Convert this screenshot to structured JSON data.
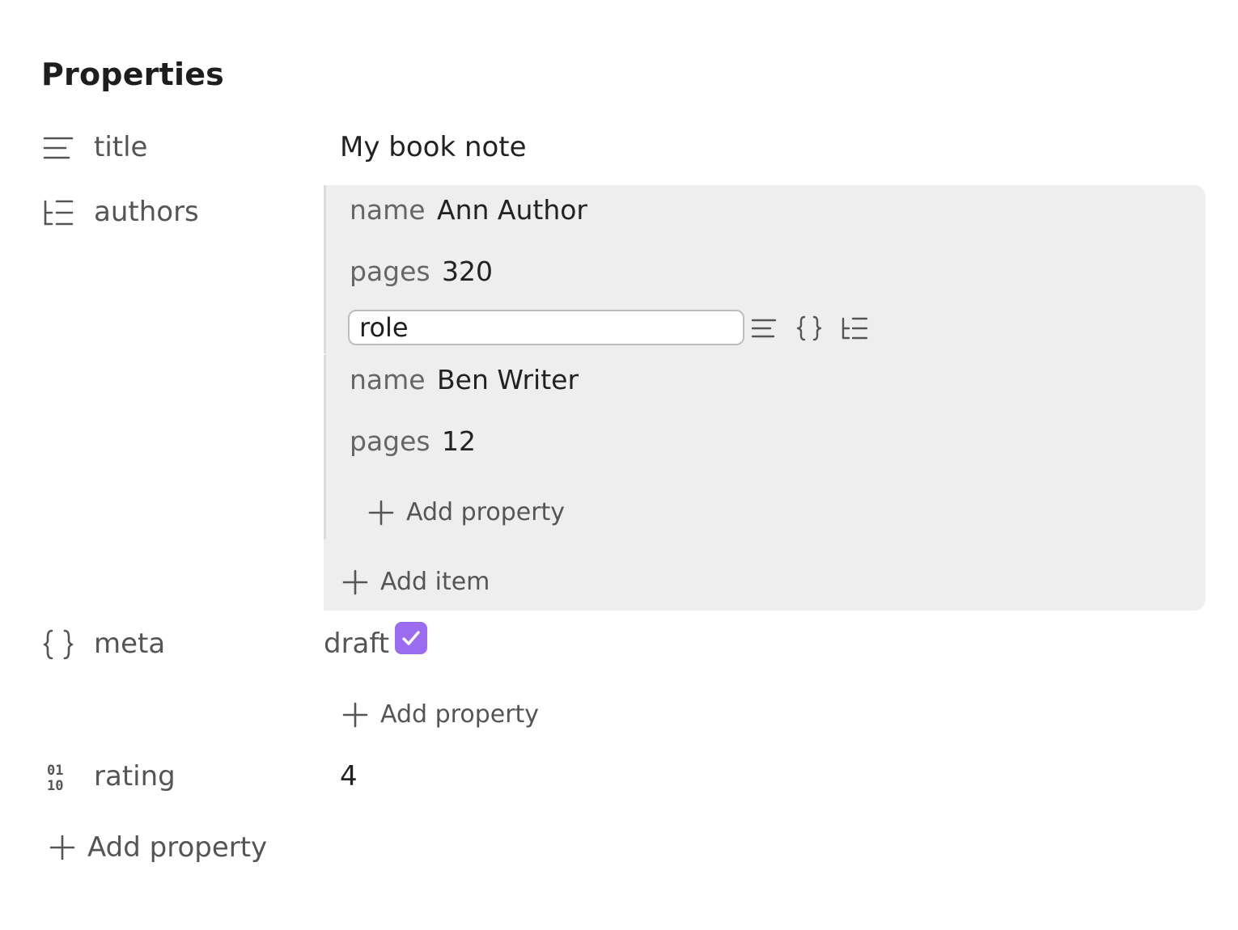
{
  "header": {
    "title": "Properties"
  },
  "properties": {
    "title": {
      "key": "title",
      "icon": "text-lines-icon",
      "value": "My book note"
    },
    "authors": {
      "key": "authors",
      "icon": "list-tree-icon",
      "items": [
        {
          "fields": [
            {
              "key": "name",
              "value": "Ann Author"
            },
            {
              "key": "pages",
              "value": "320"
            }
          ],
          "new_field": {
            "value": "role"
          }
        },
        {
          "fields": [
            {
              "key": "name",
              "value": "Ben Writer"
            },
            {
              "key": "pages",
              "value": "12"
            }
          ],
          "add_property_label": "Add property"
        }
      ],
      "add_item_label": "Add item"
    },
    "meta": {
      "key": "meta",
      "icon": "braces-icon",
      "fields": [
        {
          "key": "draft",
          "checked": true
        }
      ],
      "add_property_label": "Add property"
    },
    "rating": {
      "key": "rating",
      "icon": "binary-number-icon",
      "value": "4"
    }
  },
  "footer": {
    "add_property_label": "Add property"
  },
  "colors": {
    "accent": "#9b6cf0",
    "panel_bg": "#eeeeee",
    "muted_text": "#555555"
  }
}
